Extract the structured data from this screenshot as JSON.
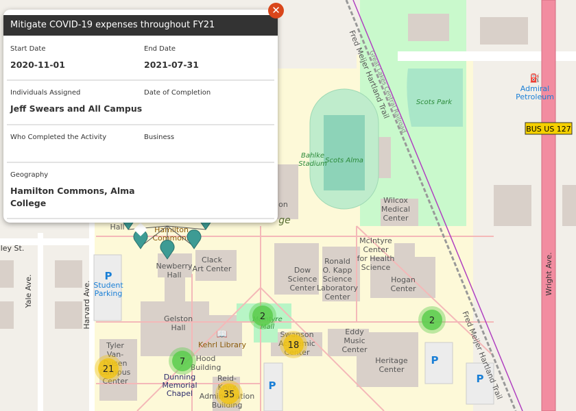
{
  "popup": {
    "title": "Mitigate COVID-19 expenses throughout FY21",
    "close_icon": "close-icon",
    "fields": [
      {
        "label": "Start Date",
        "value": "2020-11-01"
      },
      {
        "label": "End Date",
        "value": "2021-07-31"
      },
      {
        "label": "Individuals Assigned",
        "value": "Jeff Swears and All Campus"
      },
      {
        "label": "Date of Completion",
        "value": ""
      },
      {
        "label": "Who Completed the Activity",
        "value": ""
      },
      {
        "label": "Business",
        "value": ""
      },
      {
        "label": "Geography",
        "value": "Hamilton Commons, Alma College"
      }
    ]
  },
  "map": {
    "labels": {
      "fred_meijer_trail_top": "Fred Meijer Hartland Trail",
      "great_lakes_railroad": "Great Lakes Central Railroad",
      "scots_park": "Scots Park",
      "admiral": "Admiral",
      "petroleum": "Petroleum",
      "bus_us127": "BUS US 127",
      "bahlke": "Bahlke",
      "stadium": "Stadium",
      "scots_alma": "Scots Alma",
      "wilcox1": "Wilcox",
      "wilcox2": "Medical",
      "wilcox3": "Center",
      "mcintyre1": "McIntyre",
      "mcintyre2": "Center",
      "mcintyre3": "for Health",
      "mcintyre4": "Science",
      "dow1": "Dow",
      "dow2": "Science",
      "dow3": "Center",
      "kapp1": "Ronald",
      "kapp2": "O. Kapp",
      "kapp3": "Science",
      "kapp4": "Laboratory",
      "kapp5": "Center",
      "hogan1": "Hogan",
      "hogan2": "Center",
      "wright_ave": "Wright Ave.",
      "fred_meijer_trail_bottom": "Fred Meijer Hartland Trail",
      "eddy1": "Eddy",
      "eddy2": "Music",
      "eddy3": "Center",
      "heritage1": "Heritage",
      "heritage2": "Center",
      "swanson1": "Swanson",
      "swanson2": "Academic",
      "swanson3": "Center",
      "mcintyre_mall1": "McIntyre",
      "mcintyre_mall2": "Mall",
      "kehrl": "Kehrl Library",
      "gelston1": "Gelston",
      "gelston2": "Hall",
      "clack1": "Clack",
      "clack2": "Art Center",
      "newberry1": "Newberry",
      "newberry2": "Hall",
      "hamilton1": "Hamilton",
      "hamilton2": "Commons",
      "hall": "Hall",
      "hood1": "Hood",
      "hood2": "Building",
      "dunning1": "Dunning",
      "dunning2": "Memorial",
      "dunning3": "Chapel",
      "reid1": "Reid-",
      "reid2": "Knox",
      "reid3": "Administration",
      "reid4": "Building",
      "tyler1": "Tyler",
      "tyler2": "Van-",
      "tyler3": "Dusen",
      "tyler4": "Campus",
      "tyler5": "Center",
      "student_parking1": "Student",
      "student_parking2": "Parking",
      "parking_p": "P",
      "harvard": "Harvard Ave.",
      "yale": "Yale Ave.",
      "ley": "ley St.",
      "ge": "ge",
      "on": "on"
    },
    "clusters": [
      {
        "count": "2",
        "color": "green"
      },
      {
        "count": "2",
        "color": "green"
      },
      {
        "count": "7",
        "color": "green"
      },
      {
        "count": "21",
        "color": "yellow"
      },
      {
        "count": "18",
        "color": "yellow"
      },
      {
        "count": "35",
        "color": "yellow"
      }
    ],
    "colors": {
      "green_cluster": "#5ccc4e",
      "yellow_cluster": "#f0c419",
      "marker": "#3d9b94",
      "header": "#333333",
      "close": "#d9461a",
      "primary_road": "#f28ca0"
    }
  }
}
